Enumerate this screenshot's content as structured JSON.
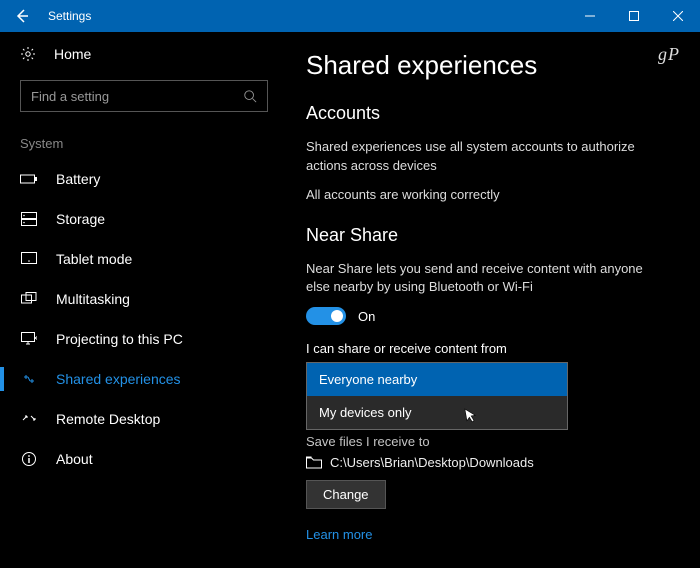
{
  "titlebar": {
    "title": "Settings"
  },
  "watermark": "gP",
  "sidebar": {
    "home": "Home",
    "search_placeholder": "Find a setting",
    "section": "System",
    "items": [
      {
        "label": "Battery"
      },
      {
        "label": "Storage"
      },
      {
        "label": "Tablet mode"
      },
      {
        "label": "Multitasking"
      },
      {
        "label": "Projecting to this PC"
      },
      {
        "label": "Shared experiences"
      },
      {
        "label": "Remote Desktop"
      },
      {
        "label": "About"
      }
    ]
  },
  "main": {
    "heading": "Shared experiences",
    "accounts": {
      "title": "Accounts",
      "desc": "Shared experiences use all system accounts to authorize actions across devices",
      "status": "All accounts are working correctly"
    },
    "near_share": {
      "title": "Near Share",
      "desc": "Near Share lets you send and receive content with anyone else nearby by using Bluetooth or Wi-Fi",
      "toggle_state": "On",
      "dropdown_label": "I can share or receive content from",
      "options": [
        "Everyone nearby",
        "My devices only"
      ],
      "save_label": "Save files I receive to",
      "save_path": "C:\\Users\\Brian\\Desktop\\Downloads",
      "change_button": "Change",
      "learn_more": "Learn more"
    }
  }
}
